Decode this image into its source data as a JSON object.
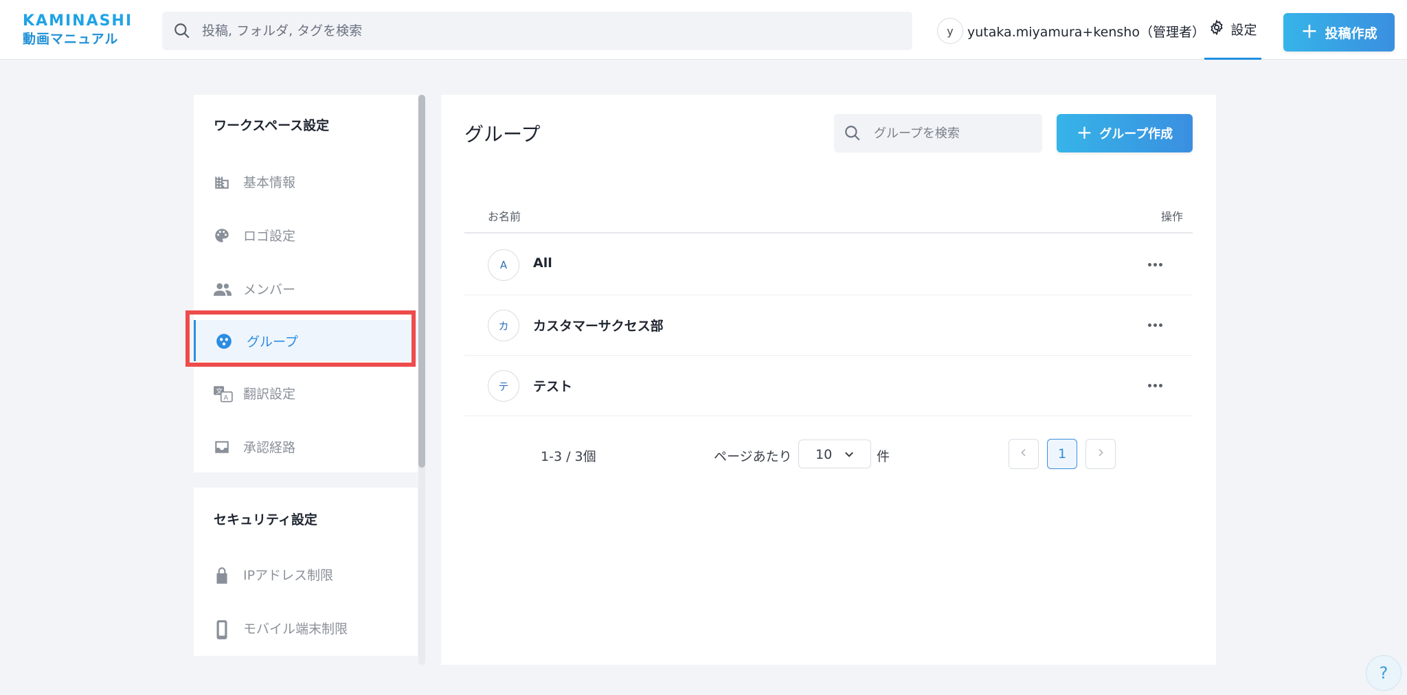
{
  "header": {
    "logo_top": "KAMINASHI",
    "logo_bottom": "動画マニュアル",
    "search_placeholder": "投稿, フォルダ, タグを検索",
    "user_initial": "y",
    "user_name": "yutaka.miyamura+kensho（管理者）",
    "settings_label": "設定",
    "new_post_label": "投稿作成"
  },
  "sidebar": {
    "workspace_title": "ワークスペース設定",
    "workspace_items": [
      {
        "label": "基本情報",
        "icon": "building-icon"
      },
      {
        "label": "ロゴ設定",
        "icon": "palette-icon"
      },
      {
        "label": "メンバー",
        "icon": "people-icon"
      },
      {
        "label": "グループ",
        "icon": "group-icon",
        "active": true
      },
      {
        "label": "翻訳設定",
        "icon": "translate-icon"
      },
      {
        "label": "承認経路",
        "icon": "inbox-icon"
      }
    ],
    "security_title": "セキュリティ設定",
    "security_items": [
      {
        "label": "IPアドレス制限",
        "icon": "lock-icon"
      },
      {
        "label": "モバイル端末制限",
        "icon": "mobile-icon"
      }
    ]
  },
  "main": {
    "title": "グループ",
    "search_placeholder": "グループを検索",
    "create_label": "グループ作成",
    "table": {
      "col_name": "お名前",
      "col_ops": "操作",
      "rows": [
        {
          "initial": "A",
          "name": "All"
        },
        {
          "initial": "カ",
          "name": "カスタマーサクセス部"
        },
        {
          "initial": "テ",
          "name": "テスト"
        }
      ]
    },
    "pagination": {
      "count": "1-3 / 3個",
      "per_page_label": "ページあたり",
      "per_page_value": "10",
      "unit": "件",
      "current_page": "1"
    }
  },
  "help": "?",
  "colors": {
    "accent": "#2c8de0",
    "highlight": "#ee4b4b"
  }
}
